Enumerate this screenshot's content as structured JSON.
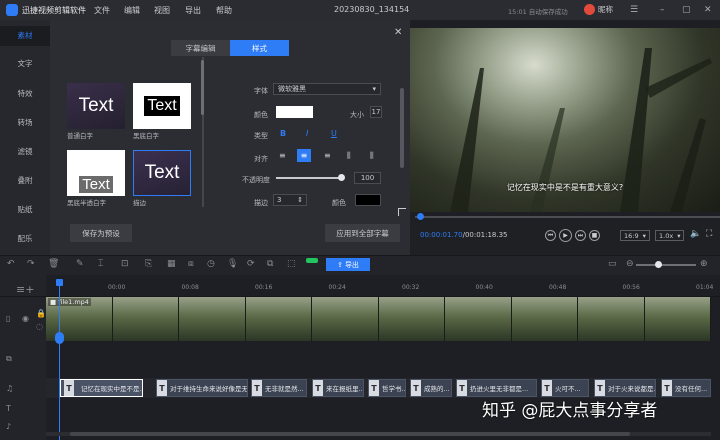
{
  "app": {
    "name": "迅捷视频剪辑软件",
    "document_title": "20230830_134154",
    "autosave": "15:01 自动保存成功",
    "user": "昵称"
  },
  "menu": [
    "文件",
    "编辑",
    "视图",
    "导出",
    "帮助"
  ],
  "left_nav": [
    "素材",
    "文字",
    "特效",
    "转场",
    "滤镜",
    "叠附",
    "贴纸",
    "配乐"
  ],
  "subtitle_panel": {
    "tabs": [
      "字幕编辑",
      "样式"
    ],
    "presets": [
      {
        "text": "Text",
        "label": "普通白字"
      },
      {
        "text": "Text",
        "label": "黑底白字"
      },
      {
        "text": "Text",
        "label": "黑底半透白字"
      },
      {
        "text": "Text",
        "label": "描边"
      }
    ],
    "font_label": "字体",
    "font_value": "微软雅黑",
    "color_label": "颜色",
    "size_label": "大小",
    "size_value": "17",
    "type_label": "类型",
    "bold": "B",
    "italic": "I",
    "underline": "U",
    "align_label": "对齐",
    "opacity_label": "不透明度",
    "opacity_value": "100",
    "stroke_label": "描边",
    "stroke_value": "3",
    "stroke_color_label": "颜色",
    "save_preset": "保存为预设",
    "apply_all": "应用到全部字幕"
  },
  "player": {
    "caption": "记忆在现实中是不是有重大意义?",
    "current_time": "00:00:01.70",
    "total_time": "00:01:18.35",
    "ratio": "16:9",
    "speed": "1.0x",
    "progress_fraction": 0.01
  },
  "toolbar": {
    "export": "导出"
  },
  "timeline": {
    "ruler": [
      "00:00",
      "00:08",
      "00:16",
      "00:24",
      "00:32",
      "00:40",
      "00:48",
      "00:56",
      "01:04",
      "01:12"
    ],
    "video_clip": "file1.mp4",
    "subtitle_clips": [
      "记忆在现实中是不是...",
      "对于维持生命来说好像是无所...",
      "无非就是然...",
      "来在报纸里...",
      "哲学书...",
      "成熟的...",
      "扔进火里无非都是...",
      "火可不...",
      "对于火来说都是...",
      "没有任何..."
    ]
  },
  "watermark": "知乎 @屁大点事分享者",
  "colors": {
    "accent": "#2e7cf6",
    "panel": "#2b2d32",
    "background": "#1e1f24"
  }
}
